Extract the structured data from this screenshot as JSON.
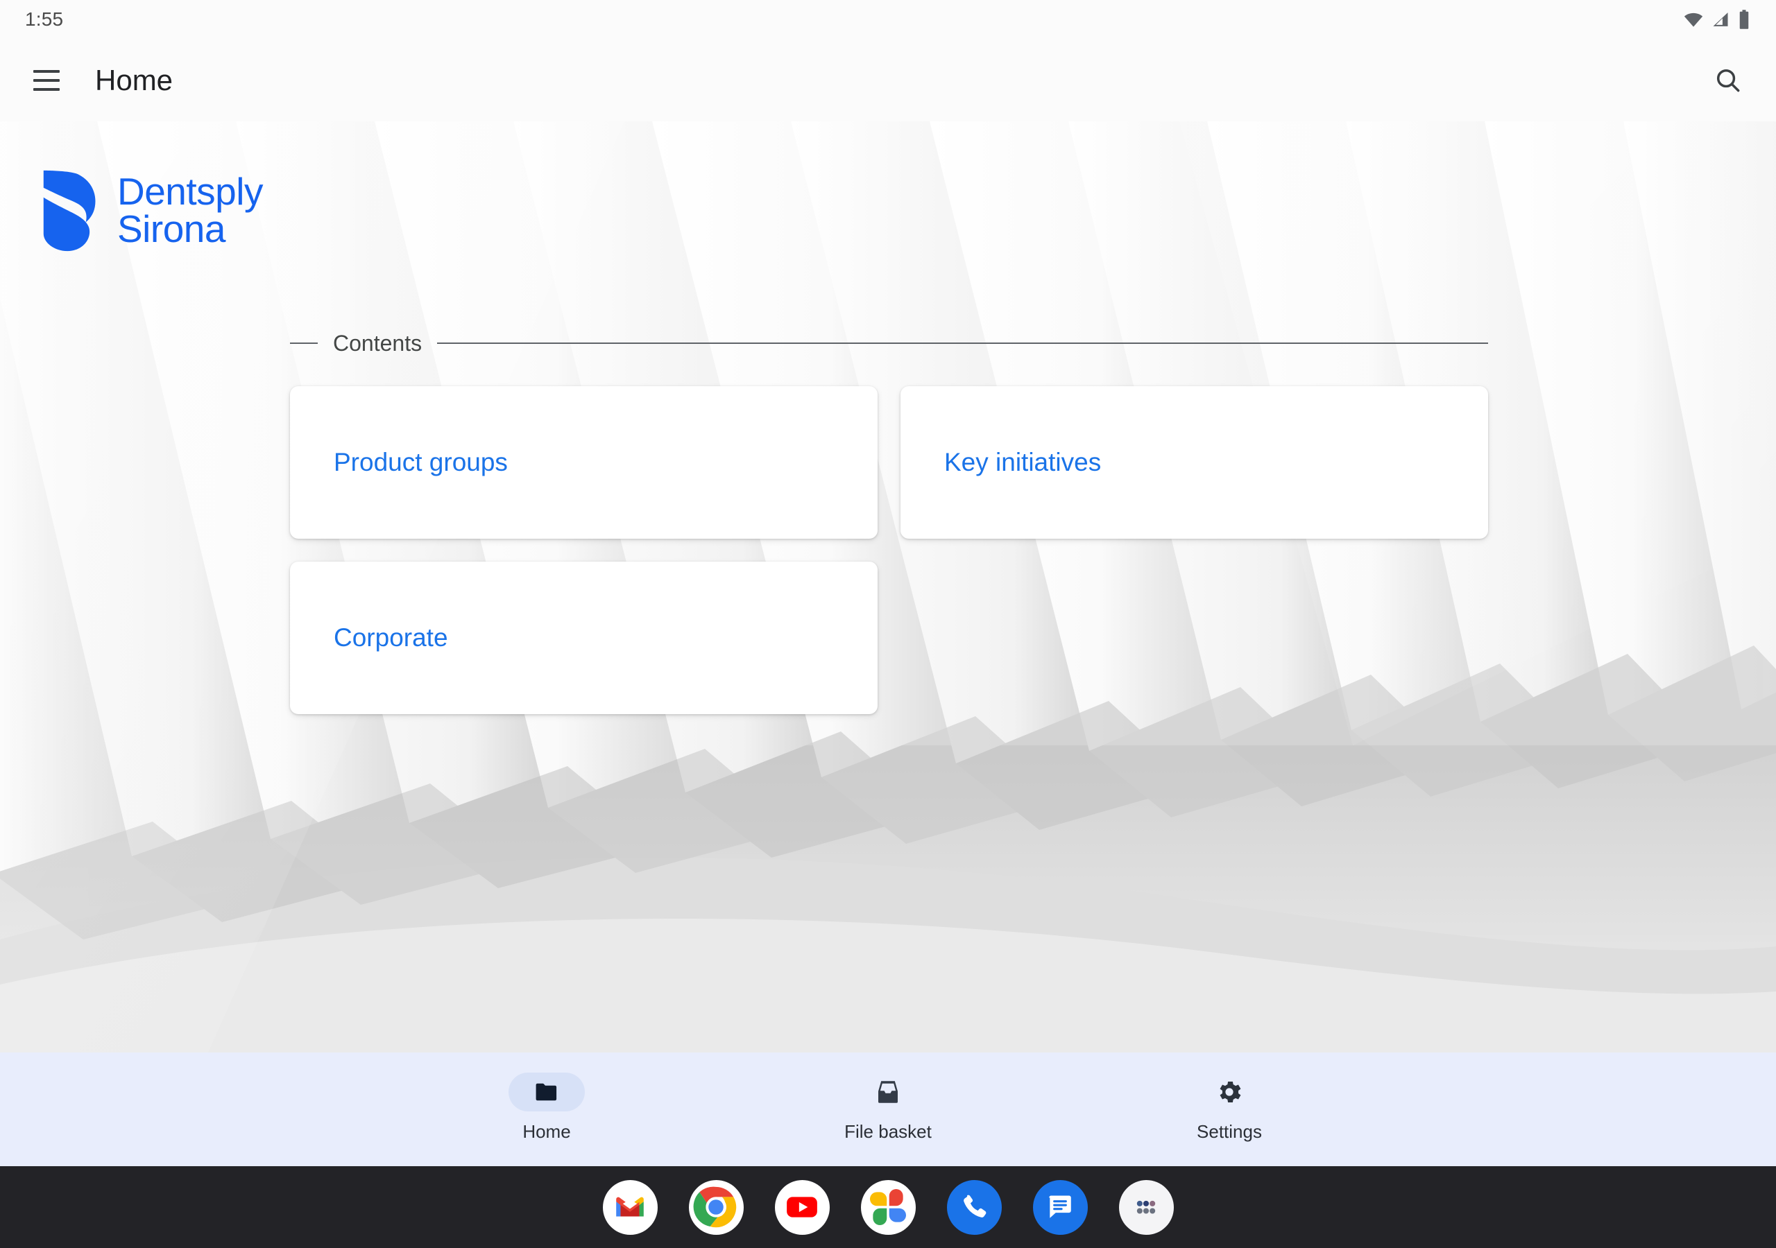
{
  "status_bar": {
    "time": "1:55",
    "icons": [
      "wifi-icon",
      "cell-signal-icon",
      "battery-icon"
    ]
  },
  "app_bar": {
    "menu_icon": "hamburger-menu-icon",
    "title": "Home",
    "search_icon": "search-icon"
  },
  "brand": {
    "logo_mark": "dentsply-sirona-s-mark",
    "line1": "Dentsply",
    "line2": "Sirona",
    "color": "#1663ee"
  },
  "contents": {
    "legend": "Contents",
    "cards": [
      {
        "label": "Product groups"
      },
      {
        "label": "Key initiatives"
      },
      {
        "label": "Corporate"
      }
    ],
    "link_color": "#1a73e8"
  },
  "bottom_nav": {
    "background": "#e8edfc",
    "items": [
      {
        "label": "Home",
        "icon": "folder-icon",
        "active": true
      },
      {
        "label": "File basket",
        "icon": "inbox-tray-icon",
        "active": false
      },
      {
        "label": "Settings",
        "icon": "gear-icon",
        "active": false
      }
    ]
  },
  "dock": {
    "background": "#232327",
    "apps": [
      {
        "name": "gmail-icon"
      },
      {
        "name": "chrome-icon"
      },
      {
        "name": "youtube-icon"
      },
      {
        "name": "google-photos-icon"
      },
      {
        "name": "phone-icon"
      },
      {
        "name": "messages-icon"
      },
      {
        "name": "app-drawer-icon"
      }
    ]
  }
}
